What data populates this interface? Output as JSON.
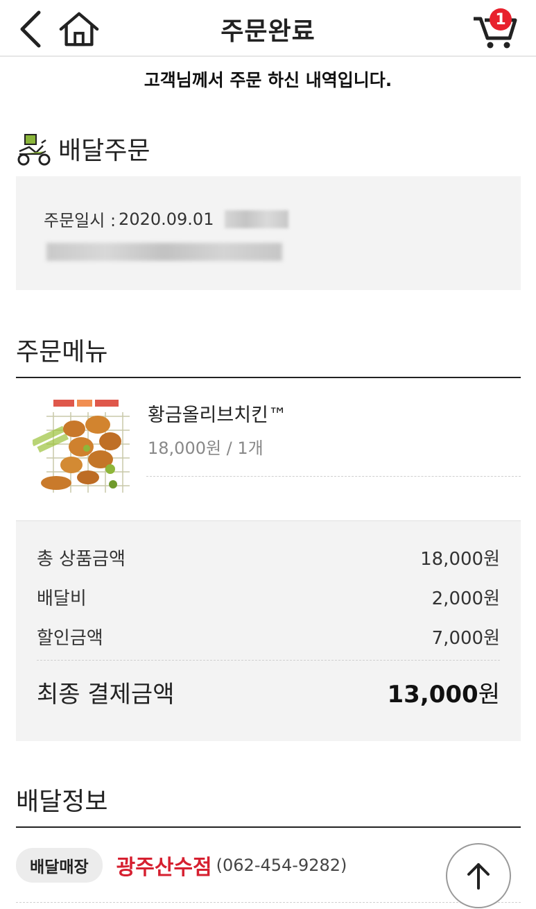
{
  "header": {
    "title": "주문완료",
    "cart_count": "1"
  },
  "subtitle": "고객님께서 주문 하신 내역입니다.",
  "delivery": {
    "title": "배달주문"
  },
  "order_info": {
    "date_label": "주문일시 :",
    "date_value": "2020.09.01"
  },
  "menu_section": {
    "title": "주문메뉴",
    "items": [
      {
        "name": "황금올리브치킨™",
        "price_qty": "18,000원 / 1개"
      }
    ]
  },
  "summary": {
    "rows": [
      {
        "label": "총 상품금액",
        "value": "18,000원"
      },
      {
        "label": "배달비",
        "value": "2,000원"
      },
      {
        "label": "할인금액",
        "value": "7,000원"
      }
    ],
    "final_label": "최종 결제금액",
    "final_amount": "13,000",
    "final_unit": "원"
  },
  "delivery_info": {
    "title": "배달정보",
    "store_chip": "배달매장",
    "store_name": "광주산수점",
    "store_phone": "(062-454-9282)"
  },
  "colors": {
    "accent_red": "#d62030",
    "badge_red": "#e8212d",
    "panel_gray": "#f3f3f3"
  },
  "icons": [
    "back-arrow-icon",
    "home-icon",
    "cart-icon",
    "delivery-scooter-icon",
    "arrow-up-icon"
  ]
}
